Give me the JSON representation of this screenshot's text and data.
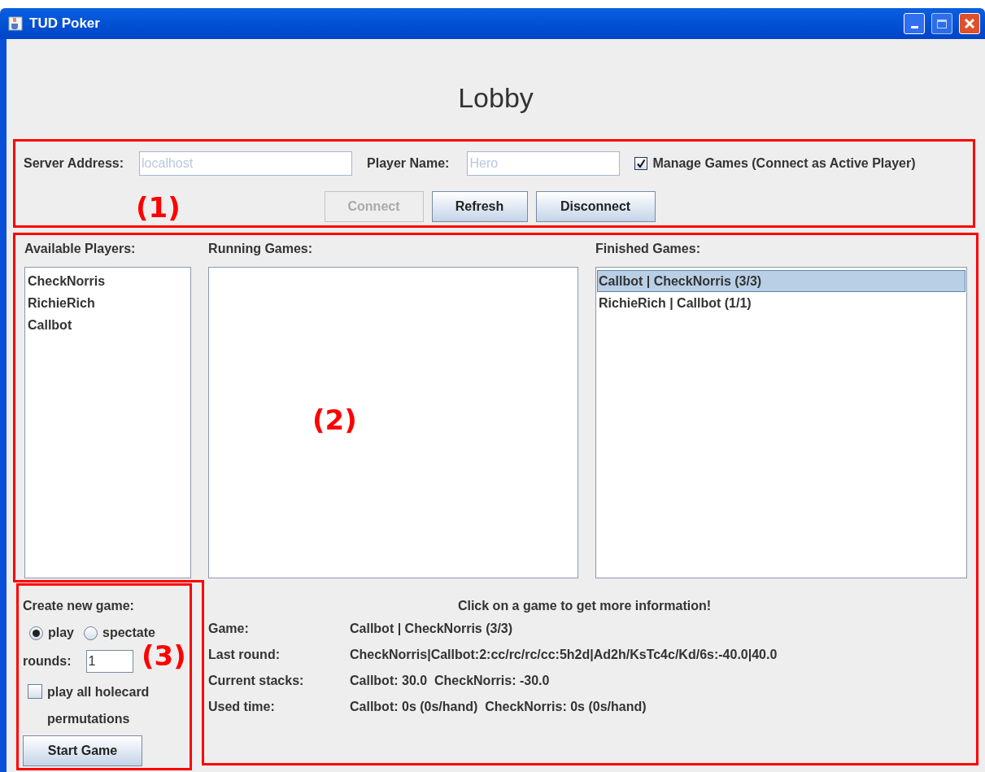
{
  "window": {
    "title": "TUD Poker"
  },
  "heading": "Lobby",
  "connection": {
    "server_address": {
      "label": "Server Address:",
      "value": "localhost",
      "disabled": true
    },
    "player_name": {
      "label": "Player Name:",
      "value": "Hero",
      "disabled": true
    },
    "manage_games": {
      "label": "Manage Games (Connect as Active Player)",
      "checked": true
    },
    "buttons": [
      {
        "label": "Connect",
        "disabled": true
      },
      {
        "label": "Refresh",
        "disabled": false
      },
      {
        "label": "Disconnect",
        "disabled": false
      }
    ]
  },
  "available_players": {
    "title": "Available Players:",
    "items": [
      {
        "label": "CheckNorris",
        "selected": false
      },
      {
        "label": "RichieRich",
        "selected": false
      },
      {
        "label": "Callbot",
        "selected": false
      }
    ]
  },
  "running_games": {
    "title": "Running Games:"
  },
  "finished_games": {
    "title": "Finished Games:",
    "items": [
      {
        "label": "Callbot | CheckNorris (3/3)",
        "selected": true
      },
      {
        "label": "RichieRich | Callbot (1/1)",
        "selected": false
      }
    ]
  },
  "create_game": {
    "title": "Create new game:",
    "modes": [
      {
        "label": "play",
        "selected": true
      },
      {
        "label": "spectate",
        "selected": false
      }
    ],
    "rounds": {
      "label": "rounds:",
      "value": "1"
    },
    "holecard_permutations": {
      "label": "play all holecard permutations",
      "checked": false
    },
    "start_button": "Start Game"
  },
  "game_info": {
    "hint": "Click on a game to get more information!",
    "rows": [
      {
        "label": "Game:",
        "value": "Callbot | CheckNorris (3/3)"
      },
      {
        "label": "Last round:",
        "value": "CheckNorris|Callbot:2:cc/rc/rc/cc:5h2d|Ad2h/KsTc4c/Kd/6s:-40.0|40.0"
      },
      {
        "label": "Current stacks:",
        "value": "Callbot: 30.0  CheckNorris: -30.0"
      },
      {
        "label": "Used time:",
        "value": "Callbot: 0s (0s/hand)  CheckNorris: 0s (0s/hand)"
      }
    ]
  },
  "annotations": [
    {
      "label": "(1)"
    },
    {
      "label": "(2)"
    },
    {
      "label": "(3)"
    }
  ]
}
